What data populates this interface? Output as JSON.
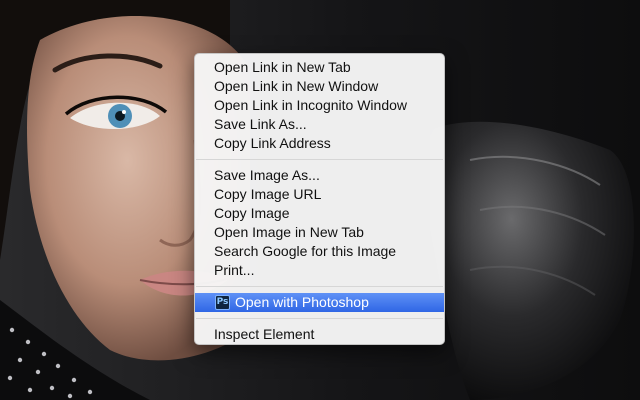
{
  "menu": {
    "groups": [
      {
        "items": [
          {
            "label": "Open Link in New Tab"
          },
          {
            "label": "Open Link in New Window"
          },
          {
            "label": "Open Link in Incognito Window"
          },
          {
            "label": "Save Link As..."
          },
          {
            "label": "Copy Link Address"
          }
        ]
      },
      {
        "items": [
          {
            "label": "Save Image As..."
          },
          {
            "label": "Copy Image URL"
          },
          {
            "label": "Copy Image"
          },
          {
            "label": "Open Image in New Tab"
          },
          {
            "label": "Search Google for this Image"
          },
          {
            "label": "Print..."
          }
        ]
      },
      {
        "items": [
          {
            "label": "Open with Photoshop",
            "icon": "photoshop-icon",
            "icon_text": "Ps",
            "highlighted": true
          }
        ]
      },
      {
        "items": [
          {
            "label": "Inspect Element"
          }
        ]
      }
    ]
  },
  "colors": {
    "highlight": "#3a70ee",
    "menu_background": "#f6f6f6",
    "photo_background": "#1a1a1c"
  }
}
